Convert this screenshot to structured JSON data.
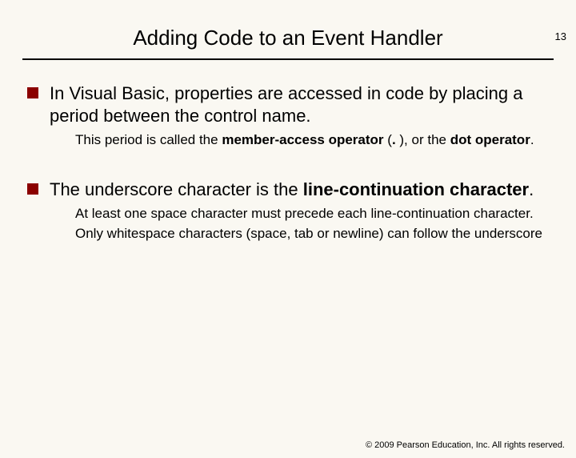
{
  "page_number": "13",
  "title": "Adding Code to an Event Handler",
  "bullets": [
    {
      "text_before": "In Visual Basic, properties are accessed in code by placing a period between the control name.",
      "subs": [
        {
          "pre": "This period is called the ",
          "bold1": "member-access operator",
          "mid": " (",
          "bold2": ".",
          "mid2": " ), or the ",
          "bold3": "dot operator",
          "post": "."
        }
      ]
    },
    {
      "pre": "The underscore character is the ",
      "bold": "line-continuation character",
      "post": ".",
      "subs": [
        {
          "text": "At least one space character must precede each line-continuation character."
        },
        {
          "text": "Only whitespace characters (space, tab or newline) can follow the underscore"
        }
      ]
    }
  ],
  "footer": "© 2009 Pearson Education, Inc.  All rights reserved."
}
